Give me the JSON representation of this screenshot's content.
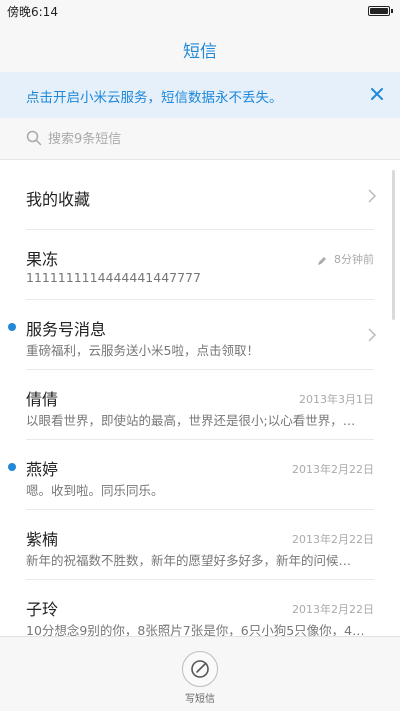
{
  "status_bar": {
    "time": "傍晚6:14"
  },
  "header": {
    "title": "短信"
  },
  "banner": {
    "text": "点击开启小米云服务，短信数据永不丢失。",
    "close_icon": "close-icon"
  },
  "search": {
    "placeholder": "搜索9条短信",
    "icon": "search-icon"
  },
  "conversations": [
    {
      "title": "我的收藏",
      "preview": "",
      "time": "",
      "unread": false,
      "chevron": true
    },
    {
      "title": "果冻",
      "preview": "1111111114444441447777",
      "time": "8分钟前",
      "unread": false,
      "draft": true
    },
    {
      "title": "服务号消息",
      "preview": "重磅福利，云服务送小米5啦，点击领取！",
      "time": "",
      "unread": true,
      "chevron": true
    },
    {
      "title": "倩倩",
      "preview": "以眼看世界，即使站的最高，世界还是很小;以心看世界，…",
      "time": "2013年3月1日",
      "unread": false
    },
    {
      "title": "燕婷",
      "preview": "嗯。收到啦。同乐同乐。",
      "time": "2013年2月22日",
      "unread": true
    },
    {
      "title": "紫楠",
      "preview": "新年的祝福数不胜数，新年的愿望好多好多，新年的问候…",
      "time": "2013年2月22日",
      "unread": false
    },
    {
      "title": "子玲",
      "preview": "10分想念9别的你，8张照片7张是你，6只小狗5只像你，4…",
      "time": "2013年2月22日",
      "unread": false
    }
  ],
  "bottom_bar": {
    "compose_label": "写短信",
    "compose_icon": "compose-icon"
  },
  "colors": {
    "accent": "#1f88d9",
    "banner_bg": "#e6f0fa",
    "bar_bg": "#f7f7f7",
    "divider": "#e9e9e9"
  }
}
